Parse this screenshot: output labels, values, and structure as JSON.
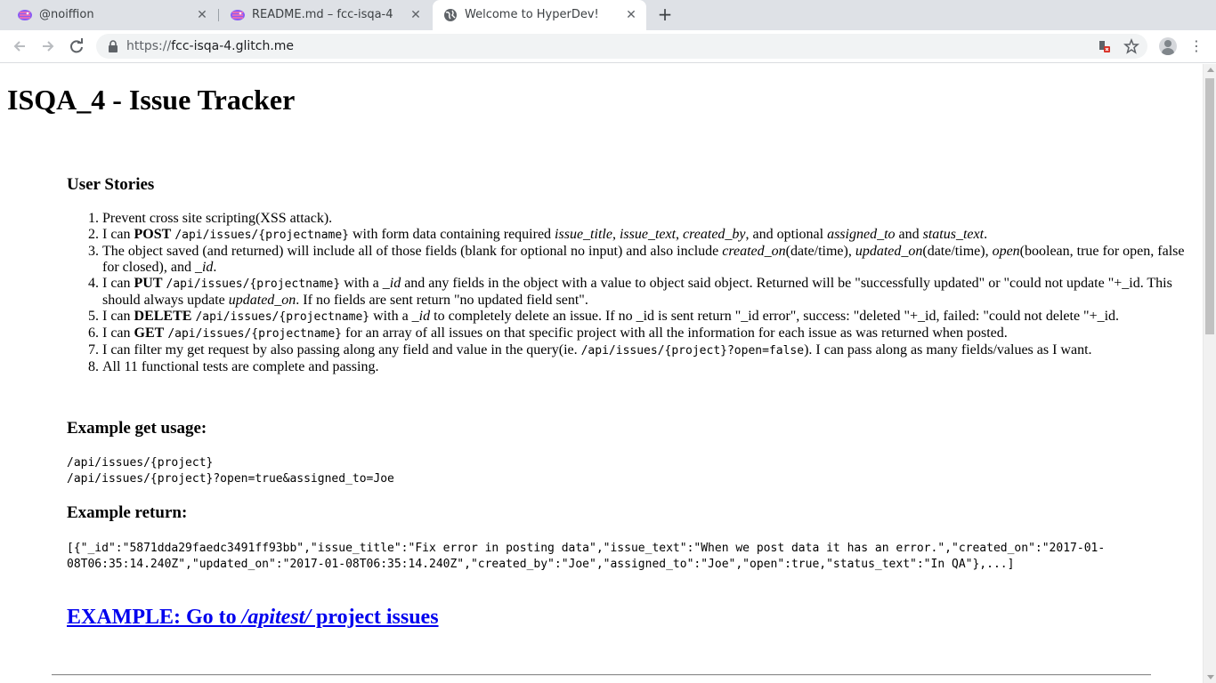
{
  "browser": {
    "tabs": [
      {
        "title": "@noiffion",
        "icon": "glitch-fish-icon",
        "active": false
      },
      {
        "title": "README.md – fcc-isqa-4",
        "icon": "glitch-fish-icon",
        "active": false
      },
      {
        "title": "Welcome to HyperDev!",
        "icon": "globe-icon",
        "active": true
      }
    ],
    "url_scheme": "https://",
    "url_host": "fcc-isqa-4.glitch.me",
    "colors": {
      "tabstrip": "#dee1e6",
      "omnibox": "#f1f3f4",
      "link": "#0000ee"
    }
  },
  "page": {
    "title": "ISQA_4 - Issue Tracker",
    "stories_heading": "User Stories",
    "stories": {
      "s1": "Prevent cross site scripting(XSS attack).",
      "s2": {
        "a": "I can ",
        "b": "POST",
        "c": " ",
        "d": "/api/issues/{projectname}",
        "e": " with form data containing required ",
        "f": "issue_title",
        "g": ", ",
        "h": "issue_text",
        "i": ", ",
        "j": "created_by",
        "k": ", and optional ",
        "l": "assigned_to",
        "m": " and ",
        "n": "status_text",
        "o": "."
      },
      "s3": {
        "a": "The object saved (and returned) will include all of those fields (blank for optional no input) and also include ",
        "b": "created_on",
        "c": "(date/time), ",
        "d": "updated_on",
        "e": "(date/time), ",
        "f": "open",
        "g": "(boolean, true for open, false for closed), and ",
        "h": "_id",
        "i": "."
      },
      "s4": {
        "a": "I can ",
        "b": "PUT",
        "c": " ",
        "d": "/api/issues/{projectname}",
        "e": " with a ",
        "f": "_id",
        "g": " and any fields in the object with a value to object said object. Returned will be \"successfully updated\" or \"could not update \"+_id. This should always update ",
        "h": "updated_on",
        "i": ". If no fields are sent return \"no updated field sent\"."
      },
      "s5": {
        "a": "I can ",
        "b": "DELETE",
        "c": " ",
        "d": "/api/issues/{projectname}",
        "e": " with a ",
        "f": "_id",
        "g": " to completely delete an issue. If no _id is sent return \"_id error\", success: \"deleted \"+_id, failed: \"could not delete \"+_id."
      },
      "s6": {
        "a": "I can ",
        "b": "GET",
        "c": " ",
        "d": "/api/issues/{projectname}",
        "e": " for an array of all issues on that specific project with all the information for each issue as was returned when posted."
      },
      "s7": {
        "a": "I can filter my get request by also passing along any field and value in the query(ie. ",
        "b": "/api/issues/{project}?open=false",
        "c": "). I can pass along as many fields/values as I want."
      },
      "s8": "All 11 functional tests are complete and passing."
    },
    "get_heading": "Example get usage:",
    "get_lines": [
      "/api/issues/{project}",
      "/api/issues/{project}?open=true&assigned_to=Joe"
    ],
    "return_heading": "Example return:",
    "return_json": "[{\"_id\":\"5871dda29faedc3491ff93bb\",\"issue_title\":\"Fix error in posting data\",\"issue_text\":\"When we post data it has an error.\",\"created_on\":\"2017-01-08T06:35:14.240Z\",\"updated_on\":\"2017-01-08T06:35:14.240Z\",\"created_by\":\"Joe\",\"assigned_to\":\"Joe\",\"open\":true,\"status_text\":\"In QA\"},...]",
    "example_link": {
      "a": "EXAMPLE: Go to ",
      "b": "/apitest/",
      "c": " project issues"
    }
  }
}
